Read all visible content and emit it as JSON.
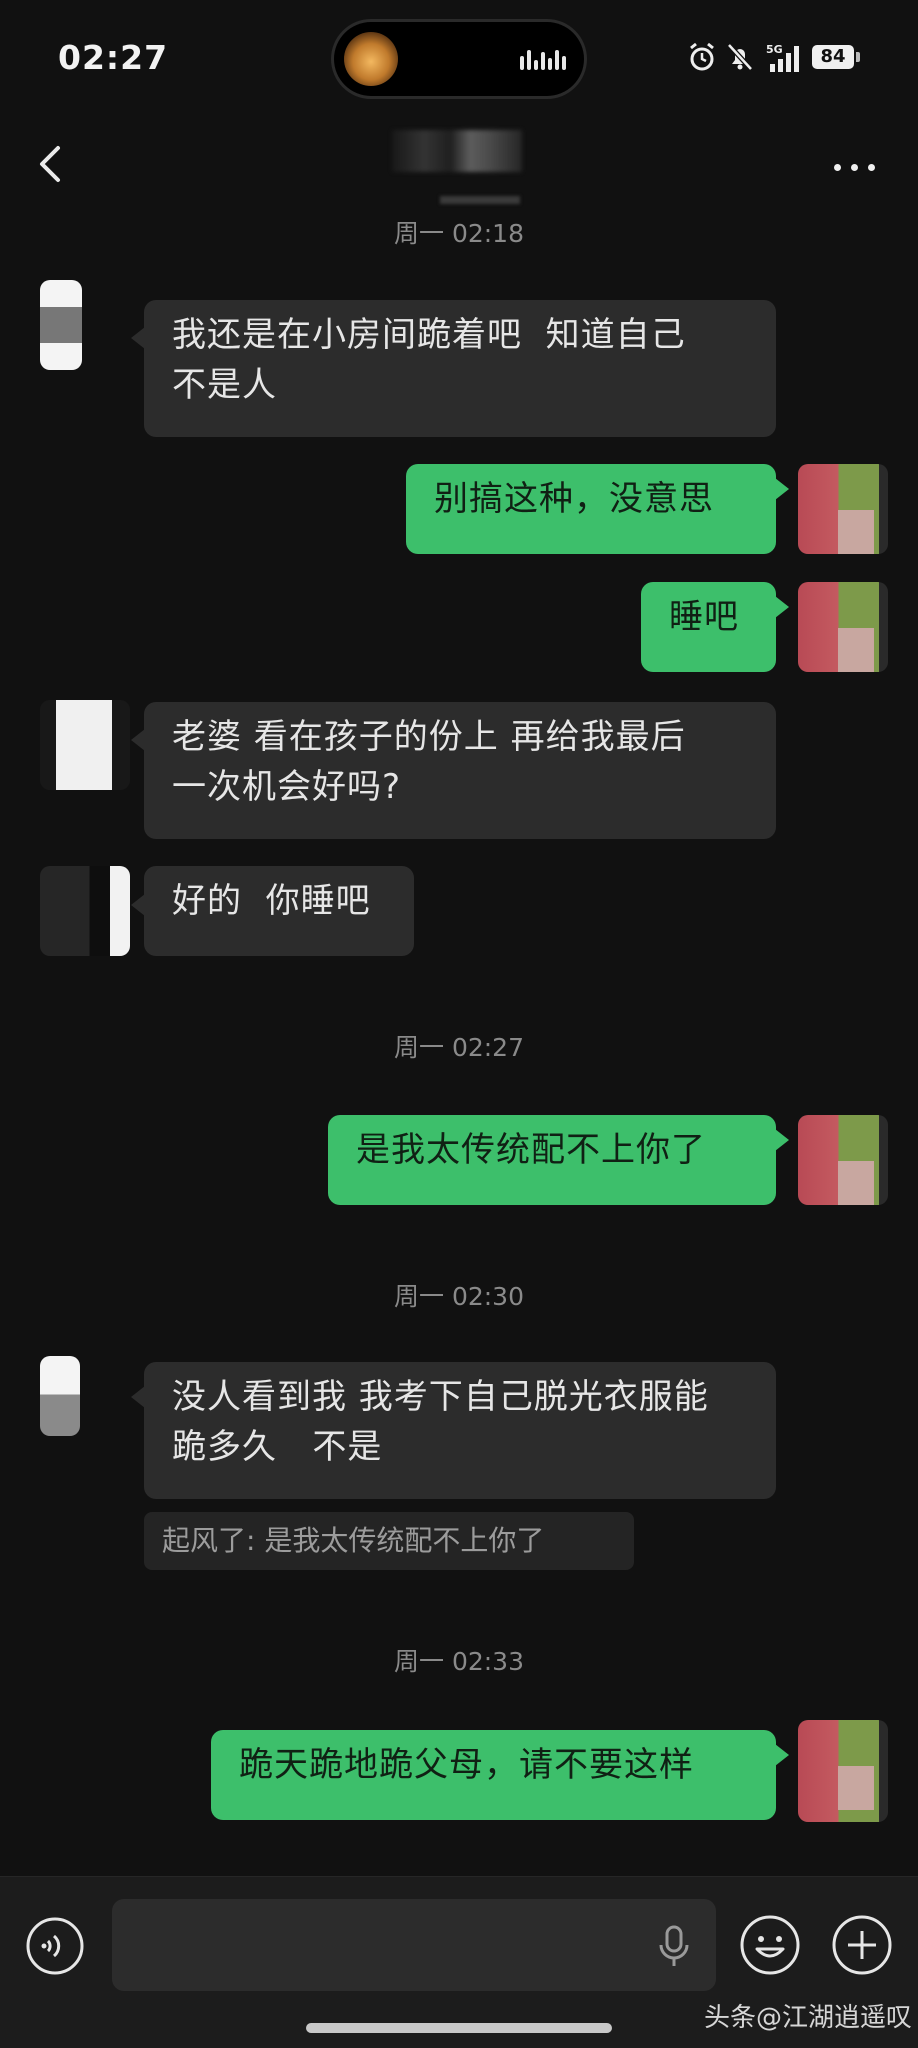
{
  "status_bar": {
    "time": "02:27",
    "network": "5G",
    "battery": "84"
  },
  "header": {
    "title": "",
    "more_icon": "more-dots-icon",
    "back_icon": "chevron-left-icon"
  },
  "colors": {
    "background": "#111111",
    "incoming_bubble": "#2c2c2c",
    "outgoing_bubble": "#3dbf6b",
    "timestamp_text": "#8a8a8a"
  },
  "messages": {
    "ts1": "周一 02:18",
    "m1": "我还是在小房间跪着吧  知道自己\n不是人",
    "m2": "别搞这种，没意思",
    "m3": "睡吧",
    "m4": "老婆 看在孩子的份上 再给我最后\n一次机会好吗?",
    "m5": "好的  你睡吧",
    "ts2": "周一 02:27",
    "m6": "是我太传统配不上你了",
    "ts3": "周一 02:30",
    "m7": "没人看到我 我考下自己脱光衣服能\n跪多久   不是",
    "m7_quote": "起风了: 是我太传统配不上你了",
    "ts4": "周一 02:33",
    "m8": "跪天跪地跪父母，请不要这样"
  },
  "input_bar": {
    "placeholder": "",
    "voice_icon": "voice-toggle-icon",
    "mic_icon": "microphone-icon",
    "emoji_icon": "emoji-icon",
    "plus_icon": "plus-icon"
  },
  "watermark": "头条@江湖逍遥叹"
}
